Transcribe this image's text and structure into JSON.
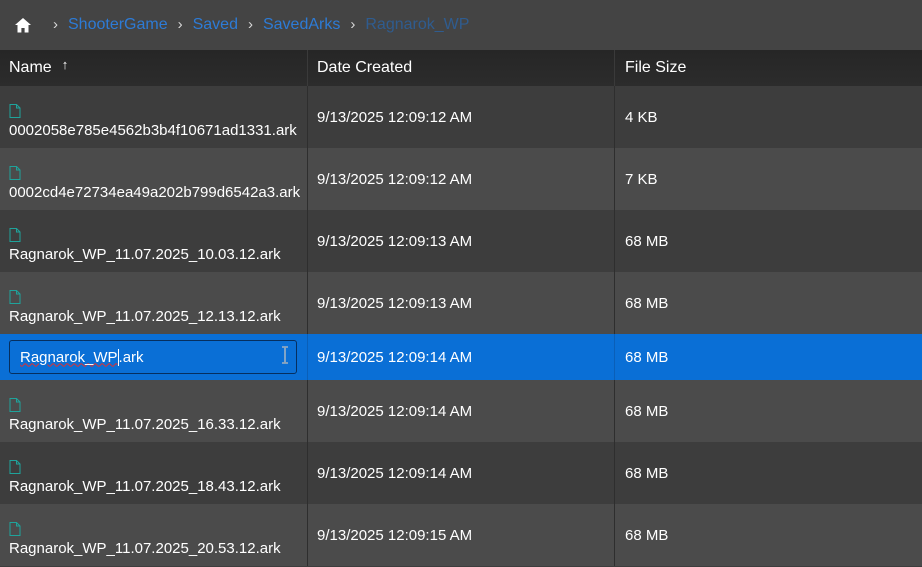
{
  "breadcrumb": {
    "items": [
      "ShooterGame",
      "Saved",
      "SavedArks",
      "Ragnarok_WP"
    ],
    "separator": "›"
  },
  "columns": {
    "name": "Name",
    "date": "Date Created",
    "size": "File Size",
    "sort_indicator": "↑"
  },
  "rows": [
    {
      "name": "0002058e785e4562b3b4f10671ad1331.ark",
      "date": "9/13/2025 12:09:12 AM",
      "size": "4 KB"
    },
    {
      "name": "0002cd4e72734ea49a202b799d6542a3.ark",
      "date": "9/13/2025 12:09:12 AM",
      "size": "7 KB"
    },
    {
      "name": "Ragnarok_WP_11.07.2025_10.03.12.ark",
      "date": "9/13/2025 12:09:13 AM",
      "size": "68 MB"
    },
    {
      "name": "Ragnarok_WP_11.07.2025_12.13.12.ark",
      "date": "9/13/2025 12:09:13 AM",
      "size": "68 MB"
    },
    {
      "name": "",
      "date": "9/13/2025 12:09:14 AM",
      "size": "68 MB"
    },
    {
      "name": "Ragnarok_WP_11.07.2025_16.33.12.ark",
      "date": "9/13/2025 12:09:14 AM",
      "size": "68 MB"
    },
    {
      "name": "Ragnarok_WP_11.07.2025_18.43.12.ark",
      "date": "9/13/2025 12:09:14 AM",
      "size": "68 MB"
    },
    {
      "name": "Ragnarok_WP_11.07.2025_20.53.12.ark",
      "date": "9/13/2025 12:09:15 AM",
      "size": "68 MB"
    }
  ],
  "rename": {
    "before_caret": "Ragnarok_WP",
    "after_caret": ".ark"
  },
  "colors": {
    "accent": "#0a6fd6",
    "link": "#2d7bd6",
    "file_icon": "#1fa39b"
  },
  "icons": {
    "home": "home-icon",
    "file": "file-icon",
    "text_cursor": "ibeam-cursor-icon"
  }
}
